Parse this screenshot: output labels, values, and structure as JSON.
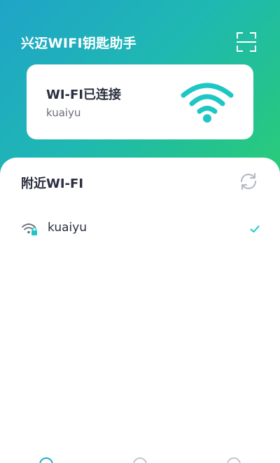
{
  "header": {
    "app_title": "兴迈WIFI钥匙助手",
    "scan_icon": "scan-icon"
  },
  "status_card": {
    "title": "WI-FI已连接",
    "ssid": "kuaiyu",
    "icon": "wifi-icon"
  },
  "nearby": {
    "title": "附近WI-FI",
    "refresh_icon": "refresh-icon",
    "networks": [
      {
        "ssid": "kuaiyu",
        "icon": "wifi-locked-icon",
        "status_icon": "check-icon"
      }
    ]
  },
  "bottom_nav": {
    "tabs": [
      {
        "icon": "tab-icon-1",
        "active": true
      },
      {
        "icon": "tab-icon-2",
        "active": false
      },
      {
        "icon": "tab-icon-3",
        "active": false
      }
    ]
  },
  "colors": {
    "accent": "#1fc7c4",
    "gradient_start": "#1fa4c8",
    "gradient_end": "#2ccf72",
    "text_dark": "#2b2f3e",
    "text_muted": "#6b6f78"
  }
}
